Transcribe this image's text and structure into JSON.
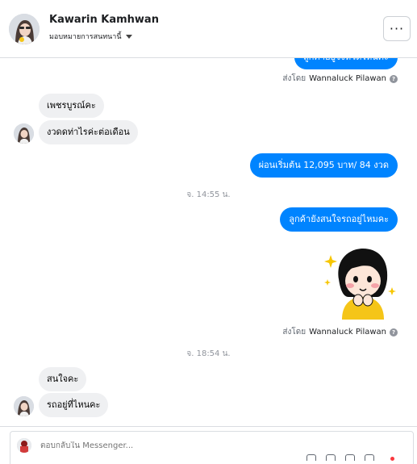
{
  "header": {
    "contact_name": "Kawarin Kamhwan",
    "assign_label": "มอบหมายการสนทนานี้",
    "more_label": "···"
  },
  "messages": [
    {
      "kind": "out",
      "text": "ลูกค้าอยู่จังหวัดไหนคะ"
    },
    {
      "kind": "sent_by",
      "prefix": "ส่งโดย",
      "name": "Wannaluck Pilawan"
    },
    {
      "kind": "in",
      "text": "เพชรบูรณ์คะ"
    },
    {
      "kind": "in",
      "text": "งวดดท่าไรค่ะต่อเดือน"
    },
    {
      "kind": "out",
      "text": "ผ่อนเริ่มต้น  12,095 บาท/ 84 งวด"
    },
    {
      "kind": "time",
      "text": "จ. 14:55 น."
    },
    {
      "kind": "out",
      "text": "ลูกค้ายังสนใจรถอยู่ไหมคะ"
    },
    {
      "kind": "sticker",
      "icon": "girl-sparkles-sticker"
    },
    {
      "kind": "sent_by",
      "prefix": "ส่งโดย",
      "name": "Wannaluck Pilawan"
    },
    {
      "kind": "time",
      "text": "จ. 18:54 น."
    },
    {
      "kind": "in",
      "text": "สนใจคะ"
    },
    {
      "kind": "in",
      "text": "รถอยู่ที่ไหนคะ"
    }
  ],
  "composer": {
    "placeholder": "ตอบกลับใน Messenger..."
  },
  "colors": {
    "outgoing_bubble": "#0084ff",
    "incoming_bubble": "#eff0f2",
    "sticker_shirt": "#f5c518"
  }
}
